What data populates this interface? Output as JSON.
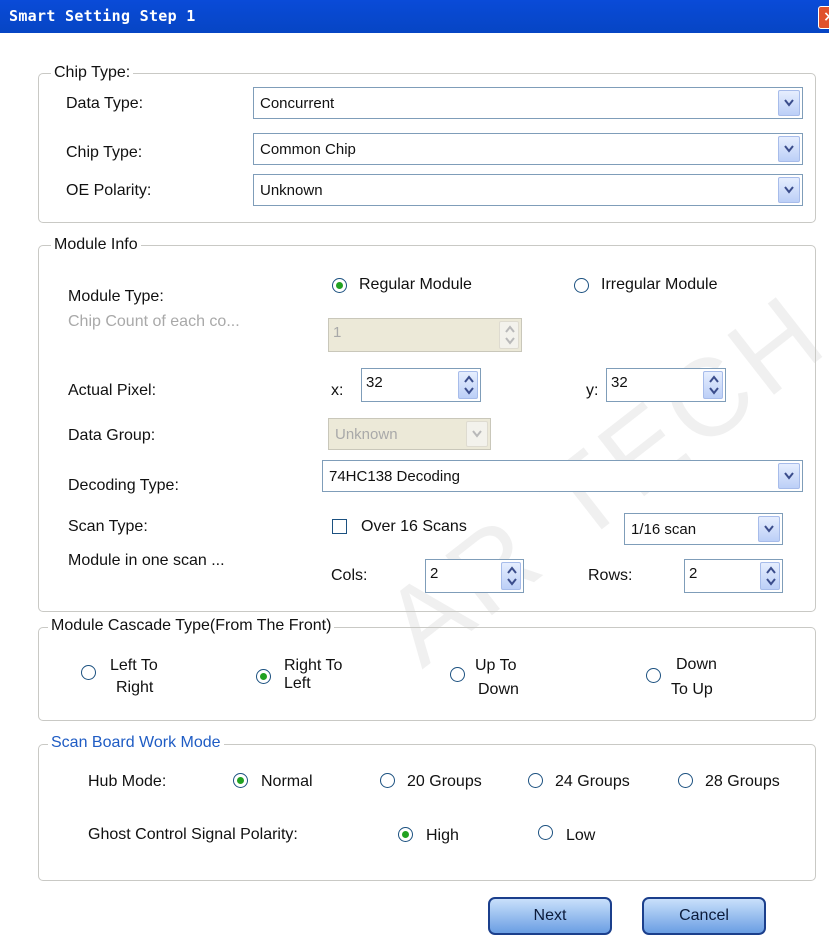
{
  "window": {
    "title": "Smart Setting Step 1",
    "close_glyph": "×"
  },
  "chip_group": {
    "legend": "Chip Type:",
    "data_type": {
      "label": "Data Type:",
      "value": "Concurrent"
    },
    "chip_type": {
      "label": "Chip Type:",
      "value": "Common Chip"
    },
    "oe_polarity": {
      "label": "OE Polarity:",
      "value": "Unknown"
    }
  },
  "module_group": {
    "legend": "Module Info",
    "module_type": {
      "label": "Module Type:",
      "regular": "Regular Module",
      "irregular": "Irregular Module",
      "selected": "regular"
    },
    "chip_count": {
      "label": "Chip Count of each co...",
      "value": "1"
    },
    "actual_pixel": {
      "label": "Actual Pixel:",
      "x_label": "x:",
      "x_value": "32",
      "y_label": "y:",
      "y_value": "32"
    },
    "data_group": {
      "label": "Data Group:",
      "value": "Unknown"
    },
    "decoding_type": {
      "label": "Decoding Type:",
      "value": "74HC138 Decoding"
    },
    "scan_type": {
      "label": "Scan Type:",
      "over16_label": "Over 16 Scans",
      "over16_checked": false,
      "value": "1/16 scan"
    },
    "module_in_scan": {
      "label": "Module in one scan ...",
      "cols_label": "Cols:",
      "cols_value": "2",
      "rows_label": "Rows:",
      "rows_value": "2"
    }
  },
  "cascade_group": {
    "legend": "Module Cascade Type(From The Front)",
    "options": [
      {
        "line1": "Left To",
        "line2": "Right",
        "selected": false
      },
      {
        "line1": "Right To",
        "line2": "Left",
        "selected": true
      },
      {
        "line1": "Up To",
        "line2": "Down",
        "selected": false
      },
      {
        "line1": "Down",
        "line2": "To Up",
        "selected": false
      }
    ]
  },
  "scanboard_group": {
    "legend": "Scan Board Work Mode",
    "legend_color": "#1f5cc4",
    "hub_mode": {
      "label": "Hub Mode:",
      "options": [
        "Normal",
        "20 Groups",
        "24 Groups",
        "28 Groups"
      ],
      "selected": "Normal"
    },
    "ghost": {
      "label": "Ghost Control Signal Polarity:",
      "high": "High",
      "low": "Low",
      "selected": "High"
    }
  },
  "buttons": {
    "next": "Next",
    "cancel": "Cancel"
  },
  "watermark": "AR TECH CO"
}
